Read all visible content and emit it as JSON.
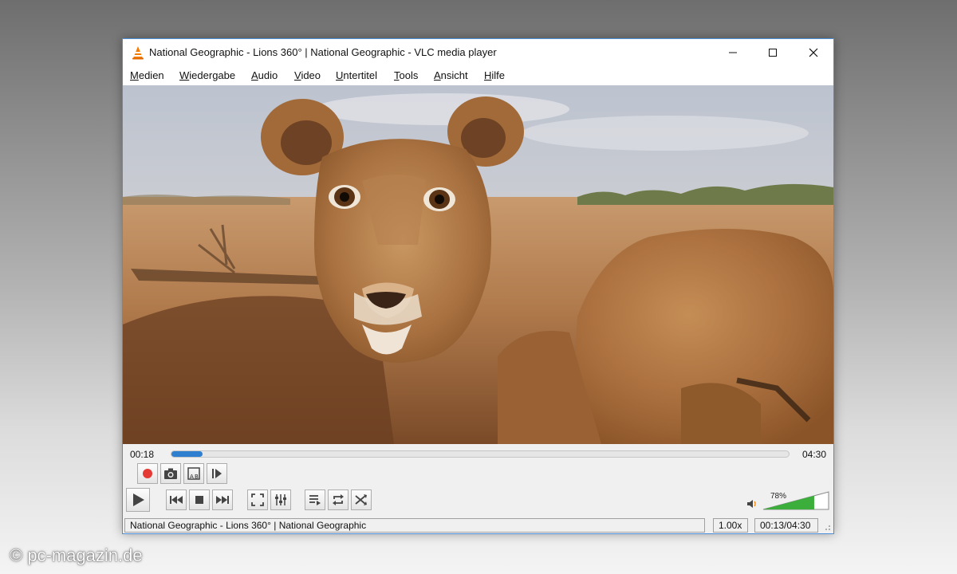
{
  "window": {
    "title": "National Geographic - Lions 360° | National Geographic - VLC media player"
  },
  "menu": [
    "Medien",
    "Wiedergabe",
    "Audio",
    "Video",
    "Untertitel",
    "Tools",
    "Ansicht",
    "Hilfe"
  ],
  "playback": {
    "elapsed": "00:18",
    "total": "04:30",
    "progress_fraction": 0.05,
    "volume_label": "78%",
    "volume_fraction": 0.78
  },
  "statusbar": {
    "media_title": "National Geographic - Lions 360° | National Geographic",
    "speed": "1.00x",
    "time": "00:13/04:30"
  },
  "video": {
    "content": "lioness close-up in savanna"
  },
  "icons": {
    "app": "vlc-cone-icon",
    "record": "record-icon",
    "snapshot": "camera-icon",
    "loop_ab": "loop-ab-icon",
    "frame_step": "frame-step-icon",
    "play": "play-icon",
    "previous": "previous-icon",
    "stop": "stop-icon",
    "next": "next-icon",
    "fullscreen": "fullscreen-icon",
    "extended_settings": "equalizer-icon",
    "playlist": "playlist-icon",
    "loop": "loop-icon",
    "shuffle": "shuffle-icon",
    "volume": "speaker-icon"
  },
  "colors": {
    "accent": "#2f7fd0",
    "record": "#e53935",
    "volume_bar": "#3cae3c",
    "vlc_orange": "#f57c00"
  },
  "watermark": "© pc-magazin.de"
}
